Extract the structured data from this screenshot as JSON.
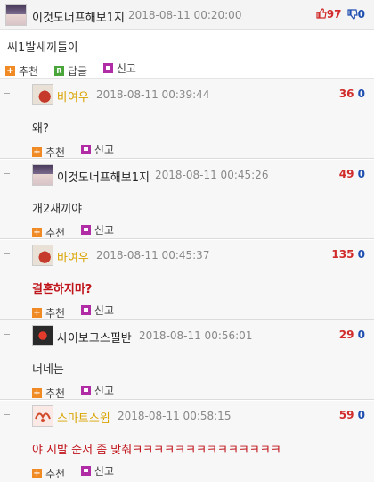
{
  "thread": {
    "root": {
      "author": "이것도너프해보1지",
      "date": "2018-08-11 00:20:00",
      "up": "97",
      "down": "0",
      "text": "씨1발새끼들아",
      "recommend_label": "추천",
      "reply_label": "답글",
      "report_label": "신고"
    },
    "re_label": "RE",
    "replies": [
      {
        "author": "바여우",
        "date": "2018-08-11 00:39:44",
        "up": "36",
        "down": "0",
        "text": "왜?",
        "recommend_label": "추천",
        "report_label": "신고"
      },
      {
        "author": "이것도너프해보1지",
        "date": "2018-08-11 00:45:26",
        "up": "49",
        "down": "0",
        "text": "개2새끼야",
        "recommend_label": "추천",
        "report_label": "신고"
      },
      {
        "author": "바여우",
        "date": "2018-08-11 00:45:37",
        "up": "135",
        "down": "0",
        "text": "결혼하지마?",
        "recommend_label": "추천",
        "report_label": "신고"
      },
      {
        "author": "사이보그스필반",
        "date": "2018-08-11 00:56:01",
        "up": "29",
        "down": "0",
        "text": "너네는",
        "recommend_label": "추천",
        "report_label": "신고"
      },
      {
        "author": "스마트스윔",
        "date": "2018-08-11 00:58:15",
        "up": "59",
        "down": "0",
        "text": "야 시발 순서 좀 맞춰ㅋㅋㅋㅋㅋㅋㅋㅋㅋㅋㅋㅋㅋㅋ",
        "recommend_label": "추천",
        "report_label": "신고"
      }
    ]
  },
  "colors": {
    "up": "#d12b2b",
    "down": "#1f4fb0",
    "recommend_icon": "#f08a24",
    "reply_icon": "#4aa53b",
    "report_icon": "#b12da6",
    "bold_reply_text": "#c0141b"
  },
  "icons": {
    "root_avatar": "anime-girl-avatar",
    "thumb_up": "thumbs-up-icon",
    "thumb_down": "thumbs-down-icon",
    "recommend": "plus-icon",
    "reply": "reply-icon",
    "report": "report-icon"
  }
}
